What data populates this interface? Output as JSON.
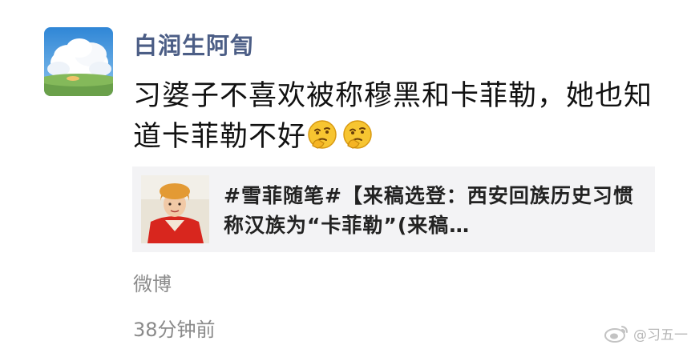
{
  "post": {
    "username": "白润生阿訇",
    "content_text": "习婆子不喜欢被称穆黑和卡菲勒，她也知道卡菲勒不好",
    "emojis": [
      "thinking-face-emoji",
      "thinking-face-emoji"
    ],
    "link_card": {
      "title": "#雪菲随笔#【来稿选登：西安回族历史习惯称汉族为“卡菲勒”(来稿…"
    },
    "source": "微博",
    "time": "38分钟前"
  },
  "watermark": {
    "text": "@习五一",
    "logo": "weibo-logo"
  },
  "colors": {
    "username": "#4c5e86",
    "text": "#111111",
    "meta": "#8a8a8a",
    "card_bg": "#f3f3f5"
  }
}
